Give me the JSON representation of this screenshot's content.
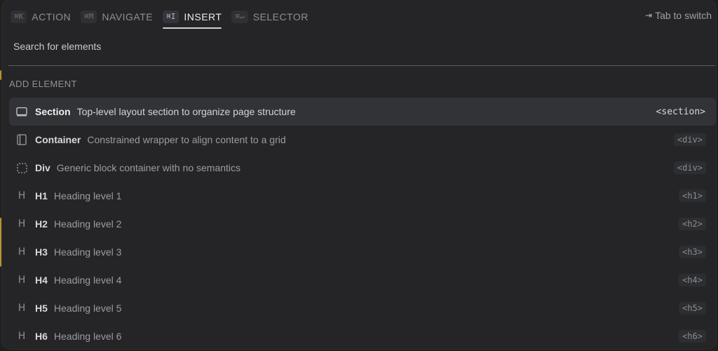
{
  "tabs": [
    {
      "shortcut": "⌘K",
      "label": "ACTION",
      "active": false
    },
    {
      "shortcut": "⌘M",
      "label": "NAVIGATE",
      "active": false
    },
    {
      "shortcut": "⌘I",
      "label": "INSERT",
      "active": true
    },
    {
      "shortcut": "⌘↵",
      "label": "SELECTOR",
      "active": false
    }
  ],
  "switch_hint": {
    "glyph": "⇥",
    "label": "Tab to switch"
  },
  "search": {
    "placeholder": "Search for elements",
    "value": ""
  },
  "section_title": "ADD ELEMENT",
  "items": [
    {
      "icon": "section-icon",
      "name": "Section",
      "desc": "Top-level layout section to organize page structure",
      "tag": "<section>",
      "selected": true
    },
    {
      "icon": "container-icon",
      "name": "Container",
      "desc": "Constrained wrapper to align content to a grid",
      "tag": "<div>",
      "selected": false
    },
    {
      "icon": "div-icon",
      "name": "Div",
      "desc": "Generic block container with no semantics",
      "tag": "<div>",
      "selected": false
    },
    {
      "icon": "heading-icon",
      "name": "H1",
      "desc": "Heading level 1",
      "tag": "<h1>",
      "selected": false
    },
    {
      "icon": "heading-icon",
      "name": "H2",
      "desc": "Heading level 2",
      "tag": "<h2>",
      "selected": false
    },
    {
      "icon": "heading-icon",
      "name": "H3",
      "desc": "Heading level 3",
      "tag": "<h3>",
      "selected": false
    },
    {
      "icon": "heading-icon",
      "name": "H4",
      "desc": "Heading level 4",
      "tag": "<h4>",
      "selected": false
    },
    {
      "icon": "heading-icon",
      "name": "H5",
      "desc": "Heading level 5",
      "tag": "<h5>",
      "selected": false
    },
    {
      "icon": "heading-icon",
      "name": "H6",
      "desc": "Heading level 6",
      "tag": "<h6>",
      "selected": false
    }
  ],
  "colors": {
    "panel_bg": "#252528",
    "selected_row_bg": "#323336",
    "accent_edge": "#b9922f"
  }
}
